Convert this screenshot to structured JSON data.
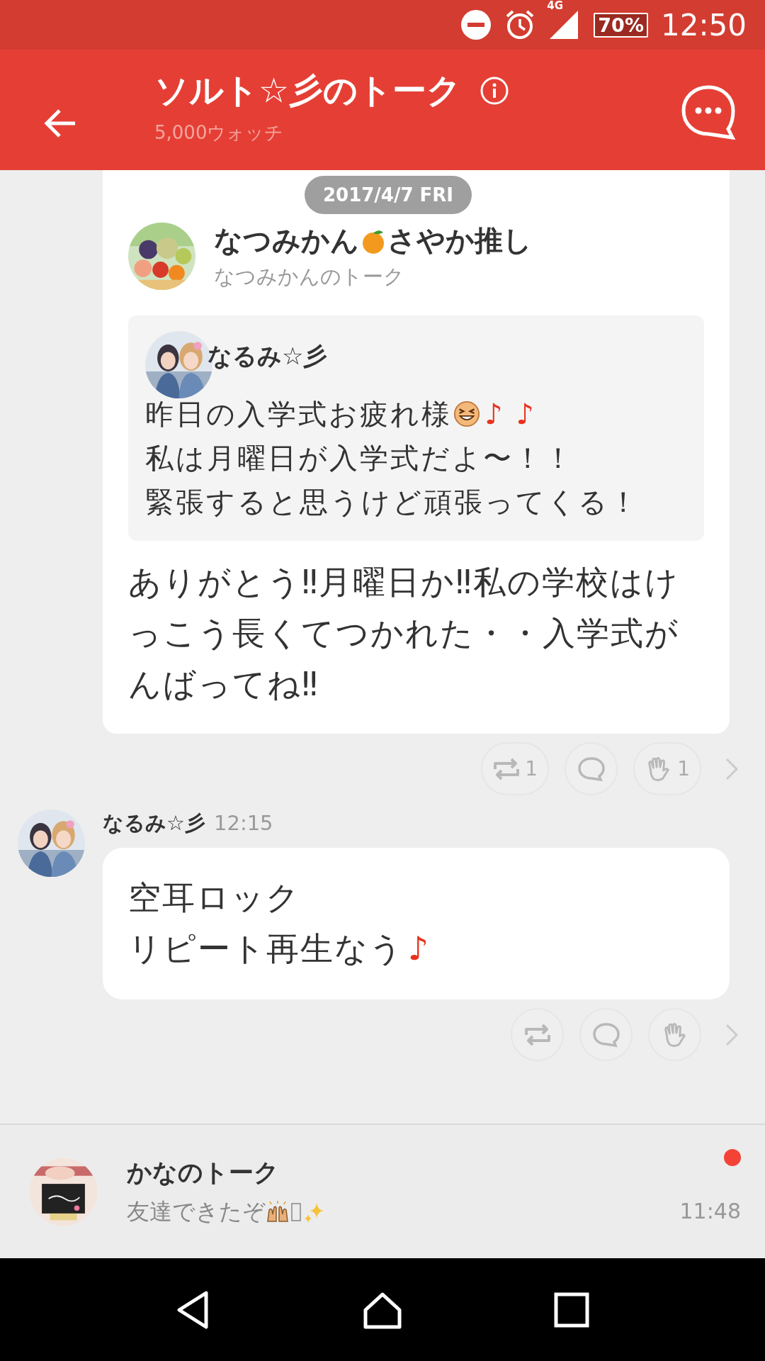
{
  "status_bar": {
    "network": "4G",
    "battery": "70%",
    "time": "12:50"
  },
  "app_bar": {
    "title": "ソルト☆彡のトーク",
    "subtitle": "5,000ウォッチ"
  },
  "date_pill": "2017/4/7 FRI",
  "shared_post": {
    "source_name_before": "なつみかん",
    "source_name_after": "さやか推し",
    "source_talk": "なつみかんのトーク",
    "quote": {
      "author": "なるみ☆彡",
      "lines": [
        [
          {
            "kind": "text",
            "text": "昨日の入学式お疲れ様"
          },
          {
            "kind": "laugh"
          },
          {
            "kind": "note",
            "text": "♪ ♪"
          }
        ],
        [
          {
            "kind": "text",
            "text": "私は月曜日が入学式だよ〜！！"
          }
        ],
        [
          {
            "kind": "text",
            "text": "緊張すると思うけど頑張ってくる！"
          }
        ]
      ]
    },
    "comment": "ありがとう‼月曜日か‼私の学校はけっこう長くてつかれた・・入学式がんばってね‼",
    "reactions": [
      {
        "kind": "repost",
        "count": "1"
      },
      {
        "kind": "comment"
      },
      {
        "kind": "clap",
        "count": "1"
      }
    ]
  },
  "message": {
    "author": "なるみ☆彡",
    "time": "12:15",
    "lines": [
      [
        {
          "kind": "text",
          "text": "空耳ロック"
        }
      ],
      [
        {
          "kind": "text",
          "text": "リピート再生なう"
        },
        {
          "kind": "note",
          "text": "♪"
        }
      ]
    ],
    "reactions": [
      {
        "kind": "repost"
      },
      {
        "kind": "comment"
      },
      {
        "kind": "clap"
      }
    ]
  },
  "notification": {
    "title": "かなのトーク",
    "preview": "友達できたぞ",
    "time": "11:48",
    "unread": true
  }
}
